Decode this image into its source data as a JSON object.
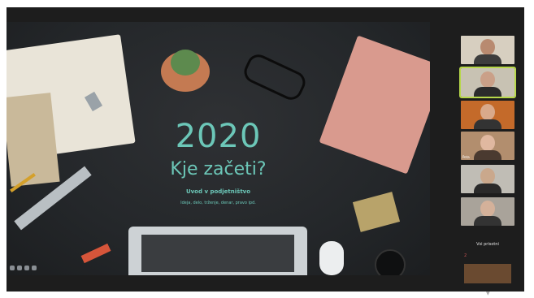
{
  "slide": {
    "year": "2020",
    "title": "Kje začeti?",
    "subtitle": "Uvod v podjetništvo",
    "subline": "Ideja, delo, trženje, denar, pravo ipd."
  },
  "participants": [
    {
      "name": ""
    },
    {
      "name": ""
    },
    {
      "name": ""
    },
    {
      "name": "Peta"
    },
    {
      "name": ""
    },
    {
      "name": ""
    }
  ],
  "panel": {
    "label": "Vsi prisotni",
    "count": "2"
  },
  "colors": {
    "accent": "#6cc7b8",
    "active_border": "#b7d84a"
  }
}
